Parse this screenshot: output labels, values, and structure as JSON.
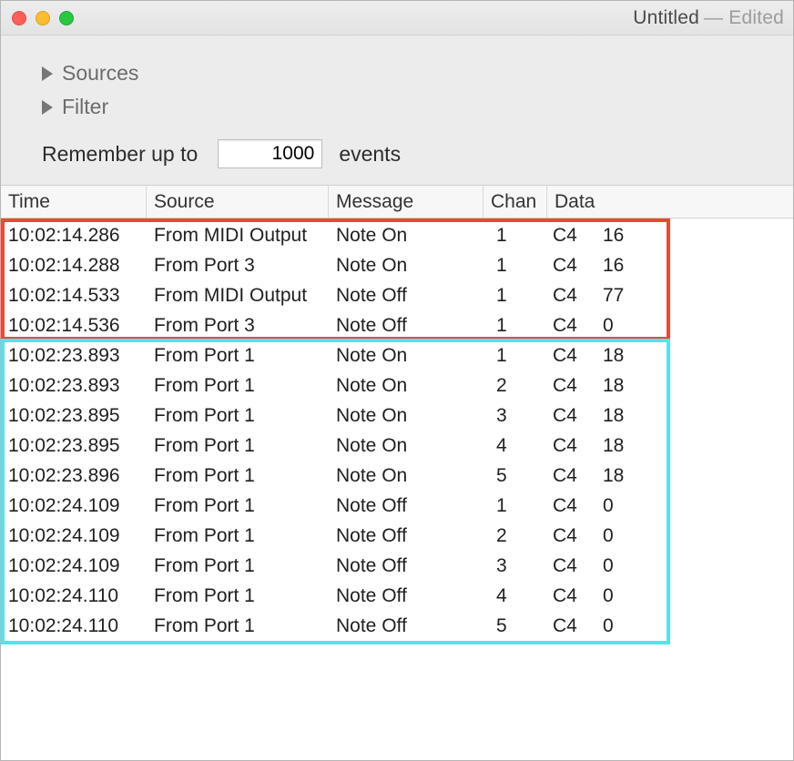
{
  "window": {
    "title": "Untitled",
    "edited_suffix": "— Edited"
  },
  "controls": {
    "sources_label": "Sources",
    "filter_label": "Filter",
    "remember_label_left": "Remember up to",
    "remember_value": "1000",
    "remember_label_right": "events"
  },
  "columns": {
    "time": "Time",
    "source": "Source",
    "message": "Message",
    "chan": "Chan",
    "data": "Data"
  },
  "rows": [
    {
      "time": "10:02:14.286",
      "source": "From MIDI Output",
      "message": "Note On",
      "chan": "1",
      "d1": "C4",
      "d2": "16"
    },
    {
      "time": "10:02:14.288",
      "source": "From Port 3",
      "message": "Note On",
      "chan": "1",
      "d1": "C4",
      "d2": "16"
    },
    {
      "time": "10:02:14.533",
      "source": "From MIDI Output",
      "message": "Note Off",
      "chan": "1",
      "d1": "C4",
      "d2": "77"
    },
    {
      "time": "10:02:14.536",
      "source": "From Port 3",
      "message": "Note Off",
      "chan": "1",
      "d1": "C4",
      "d2": "0"
    },
    {
      "time": "10:02:23.893",
      "source": "From Port 1",
      "message": "Note On",
      "chan": "1",
      "d1": "C4",
      "d2": "18"
    },
    {
      "time": "10:02:23.893",
      "source": "From Port 1",
      "message": "Note On",
      "chan": "2",
      "d1": "C4",
      "d2": "18"
    },
    {
      "time": "10:02:23.895",
      "source": "From Port 1",
      "message": "Note On",
      "chan": "3",
      "d1": "C4",
      "d2": "18"
    },
    {
      "time": "10:02:23.895",
      "source": "From Port 1",
      "message": "Note On",
      "chan": "4",
      "d1": "C4",
      "d2": "18"
    },
    {
      "time": "10:02:23.896",
      "source": "From Port 1",
      "message": "Note On",
      "chan": "5",
      "d1": "C4",
      "d2": "18"
    },
    {
      "time": "10:02:24.109",
      "source": "From Port 1",
      "message": "Note Off",
      "chan": "1",
      "d1": "C4",
      "d2": "0"
    },
    {
      "time": "10:02:24.109",
      "source": "From Port 1",
      "message": "Note Off",
      "chan": "2",
      "d1": "C4",
      "d2": "0"
    },
    {
      "time": "10:02:24.109",
      "source": "From Port 1",
      "message": "Note Off",
      "chan": "3",
      "d1": "C4",
      "d2": "0"
    },
    {
      "time": "10:02:24.110",
      "source": "From Port 1",
      "message": "Note Off",
      "chan": "4",
      "d1": "C4",
      "d2": "0"
    },
    {
      "time": "10:02:24.110",
      "source": "From Port 1",
      "message": "Note Off",
      "chan": "5",
      "d1": "C4",
      "d2": "0"
    }
  ],
  "highlight_groups": {
    "red": {
      "start": 0,
      "end": 3
    },
    "cyan": {
      "start": 4,
      "end": 13
    }
  }
}
